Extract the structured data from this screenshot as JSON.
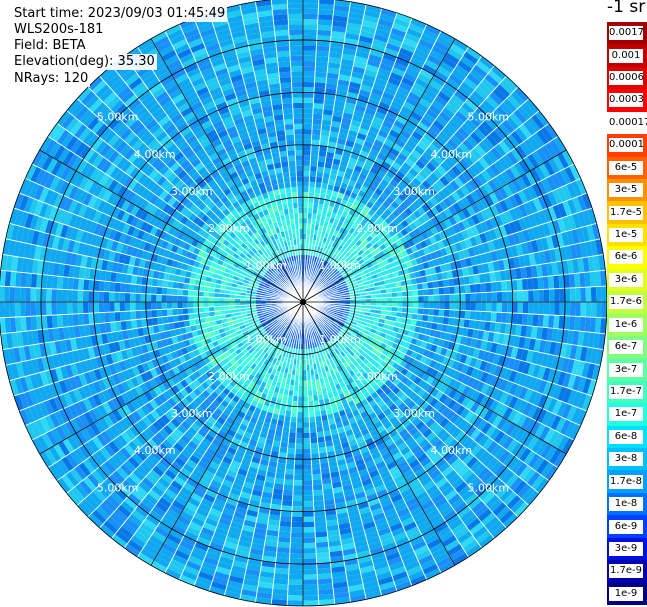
{
  "header": {
    "start_time": "Start time: 2023/09/03 01:45:49",
    "instrument": "WLS200s-181",
    "field": "Field: BETA",
    "elevation": "Elevation(deg): 35.30",
    "nrays": "NRays: 120"
  },
  "colorbar": {
    "unit_label": "-1 sr",
    "entries": [
      {
        "label": "0.0017",
        "color": "#a00000"
      },
      {
        "label": "0.001",
        "color": "#c00000"
      },
      {
        "label": "0.0006",
        "color": "#e00000"
      },
      {
        "label": "0.0003",
        "color": "#ff0000"
      },
      {
        "label": "0.00017",
        "color": "#ffffff"
      },
      {
        "label": "0.0001",
        "color": "#ff4000"
      },
      {
        "label": "6e-5",
        "color": "#ff6000"
      },
      {
        "label": "3e-5",
        "color": "#ff9000"
      },
      {
        "label": "1.7e-5",
        "color": "#ffc000"
      },
      {
        "label": "1e-5",
        "color": "#ffe000"
      },
      {
        "label": "6e-6",
        "color": "#ffff00"
      },
      {
        "label": "3e-6",
        "color": "#e0ff20"
      },
      {
        "label": "1.7e-6",
        "color": "#c0ff40"
      },
      {
        "label": "1e-6",
        "color": "#a0ff60"
      },
      {
        "label": "6e-7",
        "color": "#80ff80"
      },
      {
        "label": "3e-7",
        "color": "#60ffa0"
      },
      {
        "label": "1.7e-7",
        "color": "#40ffc0"
      },
      {
        "label": "1e-7",
        "color": "#20ffe0"
      },
      {
        "label": "6e-8",
        "color": "#00e0ff"
      },
      {
        "label": "3e-8",
        "color": "#00c0ff"
      },
      {
        "label": "1.7e-8",
        "color": "#00a0ff"
      },
      {
        "label": "1e-8",
        "color": "#0070ff"
      },
      {
        "label": "6e-9",
        "color": "#0040ff"
      },
      {
        "label": "3e-9",
        "color": "#0010e0"
      },
      {
        "label": "1.7e-9",
        "color": "#0000b0"
      },
      {
        "label": "1e-9",
        "color": "#000080"
      }
    ]
  },
  "chart_data": {
    "type": "heatmap",
    "projection": "polar PPI",
    "field": "BETA",
    "n_rays": 120,
    "range_rings_km": [
      1.0,
      2.0,
      3.0,
      4.0,
      5.0
    ],
    "ring_labels": [
      "1.00km",
      "2.00km",
      "3.00km",
      "4.00km",
      "5.00km"
    ],
    "max_range_km": 5.8,
    "azimuth_lines_deg": [
      0,
      30,
      60,
      90,
      120,
      150,
      180,
      210,
      240,
      270,
      300,
      330
    ],
    "dominant_colors": {
      "near_range": "#1060f0",
      "mid_range": "#40ffe0",
      "far_range": "#10a8f0"
    }
  }
}
